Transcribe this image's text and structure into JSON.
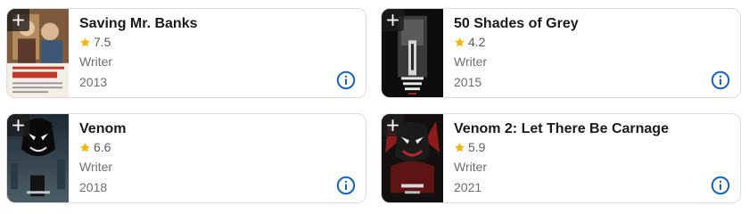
{
  "colors": {
    "accent": "#1565c0",
    "star": "#f5b50a",
    "title": "#1a1a1a",
    "muted": "#6e6e6e"
  },
  "icons": {
    "add": "plus-icon",
    "rating": "star-icon",
    "info": "info-icon"
  },
  "cards": [
    {
      "title": "Saving Mr. Banks",
      "rating": "7.5",
      "role": "Writer",
      "year": "2013"
    },
    {
      "title": "50 Shades of Grey",
      "rating": "4.2",
      "role": "Writer",
      "year": "2015"
    },
    {
      "title": "Venom",
      "rating": "6.6",
      "role": "Writer",
      "year": "2018"
    },
    {
      "title": "Venom 2: Let There Be Carnage",
      "rating": "5.9",
      "role": "Writer",
      "year": "2021"
    }
  ]
}
